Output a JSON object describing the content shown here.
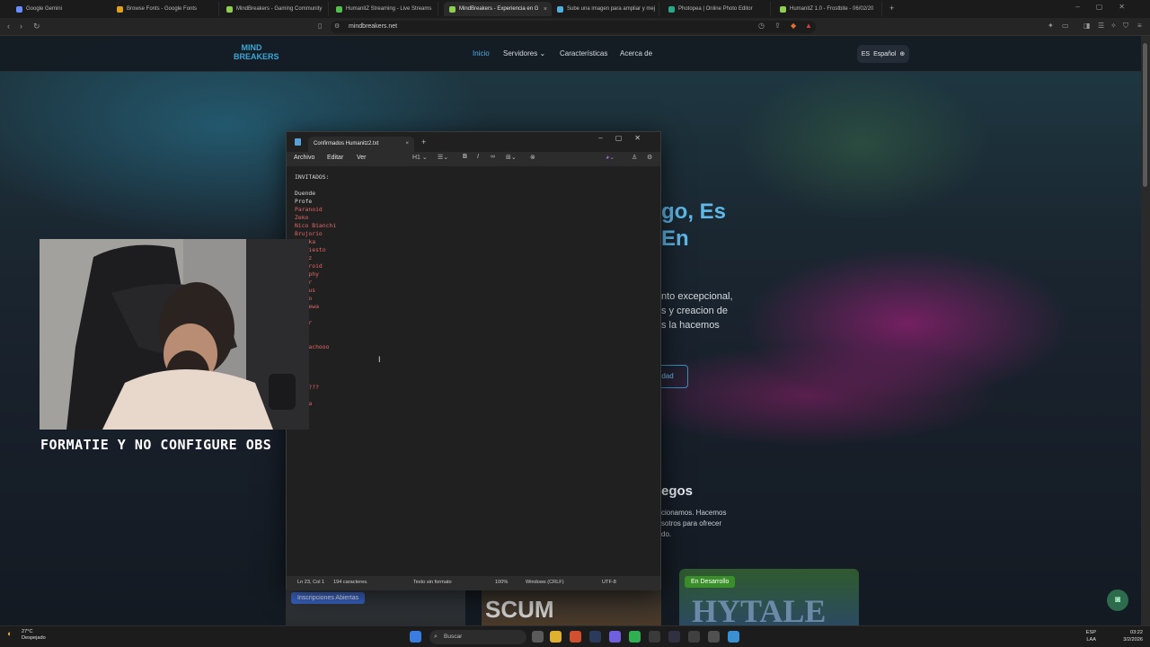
{
  "browser": {
    "tabs": [
      {
        "title": "Google Gemini",
        "color": "#6a8cff",
        "active": false
      },
      {
        "title": "Browse Fonts - Google Fonts",
        "color": "#e0a020",
        "active": false
      },
      {
        "title": "MindBreakers - Gaming Community",
        "color": "#8fcf50",
        "active": false
      },
      {
        "title": "HumanitZ Streaming - Live Streams",
        "color": "#53c04e",
        "active": false
      },
      {
        "title": "MindBreakers - Experiencia en G",
        "color": "#8fcf50",
        "active": true
      },
      {
        "title": "Sube una imagen para ampliar y mej",
        "color": "#50b0e0",
        "active": false
      },
      {
        "title": "Photopea | Online Photo Editor",
        "color": "#2aa88a",
        "active": false
      },
      {
        "title": "HumanitZ 1.0 - Frostbite - 06/02/20",
        "color": "#8fcf50",
        "active": false
      }
    ],
    "url": "mindbreakers.net"
  },
  "site": {
    "logo": "MIND\nBREAKERS",
    "nav": {
      "home": "Inicio",
      "servers": "Servidores",
      "features": "Características",
      "about": "Acerca de"
    },
    "lang": {
      "code": "ES",
      "label": "Español"
    },
    "hero": {
      "line1": "go, Es",
      "line2": "En",
      "p1": "nto excepcional,",
      "p2": "s y creacion de",
      "p3": "s la hacemos",
      "cta": "dad"
    },
    "section": {
      "title": "egos",
      "l1": "cionamos. Hacemos",
      "l2": "sotros para ofrecer",
      "l3": "do."
    },
    "cards": [
      {
        "badge": "Inscripciones Abiertas",
        "badge_color": "#3b66c8"
      },
      {
        "name": "SCUM"
      },
      {
        "badge": "En Desarrollo",
        "badge_color": "#3a8f2a",
        "name": "HYTALE"
      }
    ]
  },
  "notepad": {
    "tab_title": "Confirmados Humanitz2.txt",
    "menu": {
      "file": "Archivo",
      "edit": "Editar",
      "view": "Ver"
    },
    "heading": "H1",
    "lines": [
      "INVITADOS:",
      "",
      "Duende",
      "Profe",
      "Paranoid",
      "Zeko",
      "Nico Bianchi",
      "Brujorio",
      "   kka",
      "   fiesto",
      "   oz",
      "   eroid",
      "   aphy",
      "   er",
      "   tus",
      "   ho",
      "   pewa",
      "   u",
      "   er",
      "   u",
      "",
      "   lachooo",
      "",
      "",
      "",
      "",
      "   ????",
      "",
      "   ia"
    ],
    "status": {
      "position": "Ln 23, Col 1",
      "chars": "194 caracteres.",
      "format": "Texto sin formato",
      "zoom": "100%",
      "eol": "Windows (CRLF)",
      "encoding": "UTF-8"
    }
  },
  "stream": {
    "caption": "FORMATIE Y NO CONFIGURE OBS"
  },
  "taskbar": {
    "temp": "27°C",
    "weather": "Despejado",
    "search": "Buscar",
    "lang": "ESP",
    "lang2": "LAA",
    "time": "03:22",
    "date": "3/2/2026"
  }
}
